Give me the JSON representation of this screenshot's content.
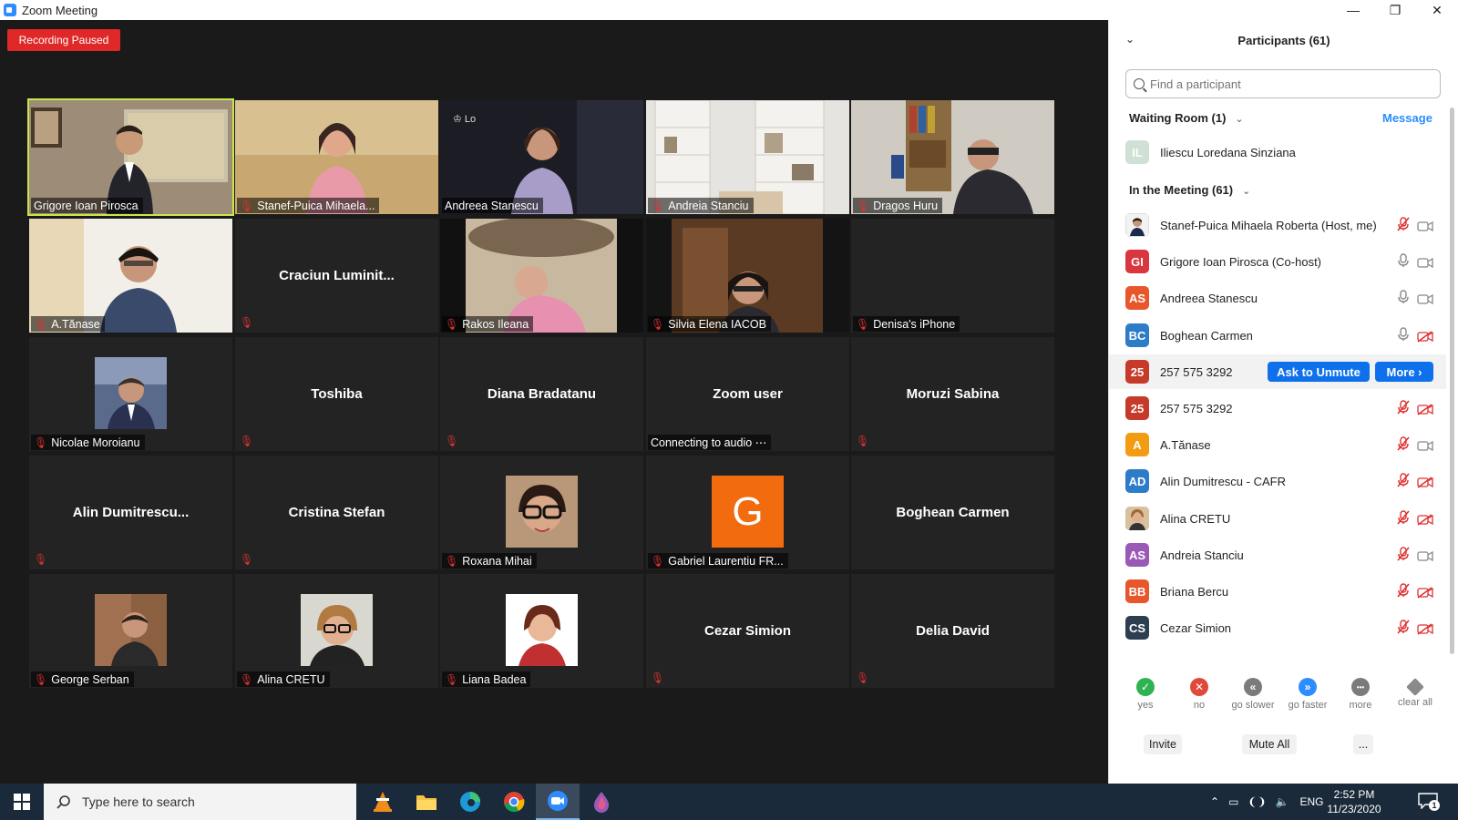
{
  "window": {
    "title": "Zoom Meeting"
  },
  "recording": {
    "label": "Recording Paused"
  },
  "tiles": [
    {
      "name": "Grigore Ioan Pirosca"
    },
    {
      "name": "Stanef-Puica Mihaela..."
    },
    {
      "name": "Andreea Stanescu"
    },
    {
      "name": "Andreia Stanciu"
    },
    {
      "name": "Dragos Huru"
    },
    {
      "name": "A.Tănase"
    },
    {
      "name": "Craciun  Luminit..."
    },
    {
      "name": "Rakos Ileana"
    },
    {
      "name": "Silvia Elena IACOB"
    },
    {
      "name": "Denisa's iPhone"
    },
    {
      "name": "Nicolae Moroianu"
    },
    {
      "name": "Toshiba"
    },
    {
      "name": "Diana Bradatanu"
    },
    {
      "name": "Zoom user",
      "status": "Connecting to audio"
    },
    {
      "name": "Moruzi Sabina"
    },
    {
      "name": "Alin  Dumitrescu..."
    },
    {
      "name": "Cristina Stefan"
    },
    {
      "name": "Roxana Mihai"
    },
    {
      "name": "Gabriel Laurentiu FR...",
      "initial": "G"
    },
    {
      "name": "Boghean Carmen"
    },
    {
      "name": "George Serban"
    },
    {
      "name": "Alina CRETU"
    },
    {
      "name": "Liana Badea"
    },
    {
      "name": "Cezar Simion"
    },
    {
      "name": "Delia David"
    }
  ],
  "panel": {
    "title": "Participants (61)",
    "search_placeholder": "Find a participant",
    "waiting_room": {
      "label": "Waiting Room (1)",
      "message": "Message"
    },
    "waiting": [
      {
        "initials": "IL",
        "name": "Iliescu Loredana Sinziana",
        "color": "#c8dcd0"
      }
    ],
    "in_meeting_label": "In the Meeting (61)",
    "participants": [
      {
        "initials": "",
        "name": "Stanef-Puica Mihaela Roberta (Host, me)",
        "color": "#ffffff",
        "mic": "muted",
        "cam": "on"
      },
      {
        "initials": "GI",
        "name": "Grigore Ioan Pirosca (Co-host)",
        "color": "#d9363e",
        "mic": "on",
        "cam": "on"
      },
      {
        "initials": "AS",
        "name": "Andreea Stanescu",
        "color": "#e8572c",
        "mic": "on",
        "cam": "on"
      },
      {
        "initials": "BC",
        "name": "Boghean Carmen",
        "color": "#2d7cc8",
        "mic": "on",
        "cam": "off"
      },
      {
        "initials": "25",
        "name": "257 575 3292",
        "color": "#c63a2a",
        "mic": "",
        "cam": ""
      },
      {
        "initials": "25",
        "name": "257 575 3292",
        "color": "#c63a2a",
        "mic": "muted",
        "cam": "off"
      },
      {
        "initials": "A",
        "name": "A.Tănase",
        "color": "#f39c12",
        "mic": "muted",
        "cam": "on"
      },
      {
        "initials": "AD",
        "name": "Alin Dumitrescu - CAFR",
        "color": "#2d7cc8",
        "mic": "muted",
        "cam": "off"
      },
      {
        "initials": "",
        "name": "Alina CRETU",
        "color": "#c9a27a",
        "mic": "muted",
        "cam": "off"
      },
      {
        "initials": "AS",
        "name": "Andreia Stanciu",
        "color": "#9b59b6",
        "mic": "muted",
        "cam": "on"
      },
      {
        "initials": "BB",
        "name": "Briana Bercu",
        "color": "#e8572c",
        "mic": "muted",
        "cam": "off"
      },
      {
        "initials": "CS",
        "name": "Cezar Simion",
        "color": "#2c3e50",
        "mic": "muted",
        "cam": "off"
      }
    ],
    "ask_unmute": "Ask to Unmute",
    "more": "More ›",
    "reactions": [
      {
        "label": "yes",
        "color": "#2eb351",
        "glyph": "✓"
      },
      {
        "label": "no",
        "color": "#e0483b",
        "glyph": "✕"
      },
      {
        "label": "go slower",
        "color": "#7b7b7b",
        "glyph": "«"
      },
      {
        "label": "go faster",
        "color": "#2d8cff",
        "glyph": "»"
      },
      {
        "label": "more",
        "color": "#7b7b7b",
        "glyph": "•••"
      },
      {
        "label": "clear all",
        "color": "#8a8a8a",
        "glyph": ""
      }
    ],
    "invite": "Invite",
    "mute_all": "Mute All",
    "ellipsis": "..."
  },
  "taskbar": {
    "search_text": "Type here to search",
    "lang": "ENG",
    "time": "2:52 PM",
    "date": "11/23/2020",
    "notif_count": "1"
  }
}
